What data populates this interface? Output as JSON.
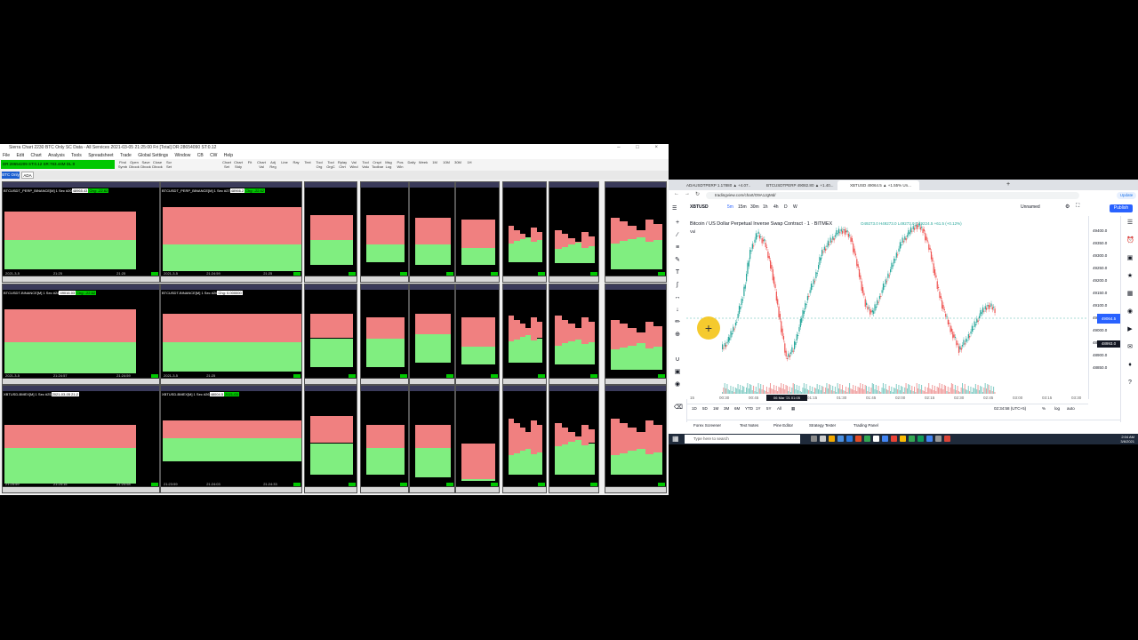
{
  "sierra": {
    "title": "Sierra Chart 2230 BTC Only  SC Data - All Services 2021-03-05 21:25:00 Fri [Total] DR:28654090 ST:0.12",
    "menu": [
      "File",
      "Edit",
      "Chart",
      "Analysis",
      "Tools",
      "Spreadsheet",
      "Trade",
      "Global Settings",
      "Window",
      "CB",
      "CW",
      "Help"
    ],
    "status": "DR:28654209 ST:0.12 SR:783.44M DL:0",
    "toolbar": [
      "Find\nSymb",
      "Open\nDbook",
      "Save\nDbook",
      "Close\nDbook",
      "Scr\nSet",
      "",
      "",
      "",
      "",
      "Chart\nSet",
      "Chart\nStdy",
      "Fit",
      "Chart\nVal",
      "Adj\nReg",
      "Line",
      "Ray",
      "Text",
      "Tool\nOrg",
      "Tool\nOrgC",
      "Rplay\nChrt",
      "Val\nWind",
      "Tool\nValu",
      "Crspt\nToolbar",
      "Msg\nLog",
      "Pos\nWin",
      "Daily",
      "Week",
      "1M",
      "10M",
      "30M",
      "1H"
    ],
    "tabs": {
      "active": "BTC Only",
      "second": "ADA"
    },
    "tiles": [
      {
        "title": "BTCUSDT_PERP_BINANCE[M] 1 Sec  #20",
        "hl": "48965.43",
        "gl": "Chg: -22.62",
        "t1": "2021-3-5",
        "t2": "21:25",
        "t3": "21:25"
      },
      {
        "title": "BTCUSDT_PERP_BINANCE[M] 1 Sec  #27",
        "hl": "48966.2",
        "gl": "Chg: -22.62",
        "t1": "2021-3-5",
        "t2": "21:24:59",
        "t3": "21:25"
      },
      {
        "title": "BTCUSDT-BINANCE[M] 1 Sec  #24",
        "hl": "49016.03",
        "gl": "Chg: -22.62",
        "t1": "2021-3-5",
        "t2": "21:24:57",
        "t3": "21:24:59"
      },
      {
        "title": "BTCUSDT-BINANCE[M] 1 Sec  #26",
        "hl": "Chg: 0.000000",
        "gl": "",
        "t1": "2021-3-5",
        "t2": "21:25",
        "t3": ""
      },
      {
        "title": "XBTUSD-BMEX[M] 1 Sec  #25",
        "hl": "2021-03-05 21:2",
        "gl": "",
        "t1": "21:25:59",
        "t2": "21:24:15",
        "t3": "21:24:58"
      },
      {
        "title": "XBTUSD-BMEX[M] 1 Sec  #26",
        "hl": "48004.5",
        "gl": "2021-03",
        "t1": "21:23:59",
        "t2": "21:24:03",
        "t3": "21:24:33"
      }
    ]
  },
  "browser": {
    "tabs": [
      "ADAUSDTPERP 1.17880 ▲ +4.07...",
      "BTCUSDTPERP 49082.80 ▲ +1.40...",
      "XBTUSD 49064.5 ▲ +1.55% Un..."
    ],
    "url": "tradingview.com/chart/O9A1JgMd/",
    "update_label": "Update",
    "symbol": "XBTUSD",
    "intervals": [
      "5m",
      "15m",
      "30m",
      "1h",
      "4h",
      "D",
      "W"
    ],
    "unnamed": "Unnamed",
    "publish_label": "Publish",
    "chart_title": "Bitcoin / US Dollar Perpetual Inverse Swap Contract · 1 · BITMEX",
    "ohlc": "O49273.0 H49273.0 L49273.0 C49224.5 +61.5 (+0.12%)",
    "vol_label": "Vol",
    "price_scale": [
      "49400.0",
      "49350.0",
      "49300.0",
      "49250.0",
      "49200.0",
      "49150.0",
      "49100.0",
      "49050.0",
      "49000.0",
      "48950.0",
      "48900.0",
      "48850.0"
    ],
    "price_tag": "49064.5",
    "price_tag2": "48993.0",
    "time_axis": [
      "15",
      "00:30",
      "00:45",
      "01:00",
      "01:15",
      "01:30",
      "01:45",
      "02:00",
      "02:15",
      "02:30",
      "02:45",
      "03:00",
      "03:15",
      "03:30"
    ],
    "time_highlight": "06 Mar '21   01:05",
    "ranges": [
      "1D",
      "5D",
      "1M",
      "3M",
      "6M",
      "YTD",
      "1Y",
      "5Y",
      "All"
    ],
    "time_readout": "02:34:58 (UTC+5)",
    "scale_opts": [
      "%",
      "log",
      "auto"
    ],
    "bottom_tabs": [
      "Forex Screener",
      "Text Notes",
      "Pine Editor",
      "Strategy Tester",
      "Trading Panel"
    ],
    "search_placeholder": "Type here to search",
    "clock_time": "2:04 AM",
    "clock_date": "3/6/2021"
  }
}
